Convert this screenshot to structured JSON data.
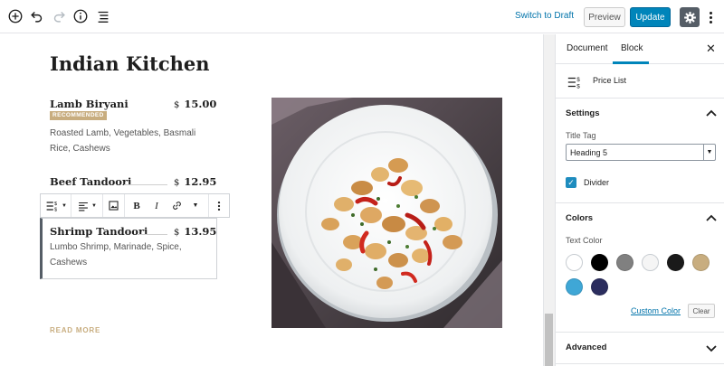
{
  "toolbar": {
    "switch_to_draft": "Switch to Draft",
    "preview": "Preview",
    "update": "Update",
    "icons": [
      "add-block-icon",
      "undo-icon",
      "redo-icon",
      "info-icon",
      "outline-icon",
      "gear-icon",
      "more-vertical-icon"
    ]
  },
  "editor": {
    "title": "Indian Kitchen",
    "items": [
      {
        "name": "Lamb Biryani",
        "currency": "$",
        "price": "15.00",
        "badge": "RECOMMENDED",
        "description": "Roasted Lamb, Vegetables, Basmali Rice, Cashews"
      },
      {
        "name": "Beef Tandoori",
        "currency": "$",
        "price": "12.95"
      },
      {
        "name": "Shrimp Tandoori",
        "currency": "$",
        "price": "13.95",
        "description": "Lumbo Shrimp, Marinade, Spice, Cashews"
      }
    ],
    "read_more": "READ MORE",
    "block_toolbar_icons": [
      "price-list-icon",
      "align-icon",
      "image-icon",
      "bold-icon",
      "italic-icon",
      "link-icon",
      "more-options-icon"
    ],
    "bold_glyph": "B",
    "italic_glyph": "I"
  },
  "sidebar": {
    "tabs": [
      "Document",
      "Block"
    ],
    "active_tab": "Block",
    "block_name": "Price List",
    "settings": {
      "title": "Settings",
      "title_tag_label": "Title Tag",
      "title_tag_value": "Heading 5",
      "divider_label": "Divider",
      "divider_checked": true
    },
    "colors": {
      "title": "Colors",
      "text_color_label": "Text Color",
      "swatches": [
        "#ffffff",
        "#000000",
        "#808080",
        "#f5f5f5",
        "#1a1a1a",
        "#c8ad7f",
        "#3fa7d6",
        "#2b2d5e"
      ],
      "custom_color": "Custom Color",
      "clear": "Clear"
    },
    "advanced": {
      "title": "Advanced"
    }
  },
  "accent_colors": {
    "primary": "#0085ba",
    "badge": "#c8ad7f",
    "link": "#0073aa"
  }
}
